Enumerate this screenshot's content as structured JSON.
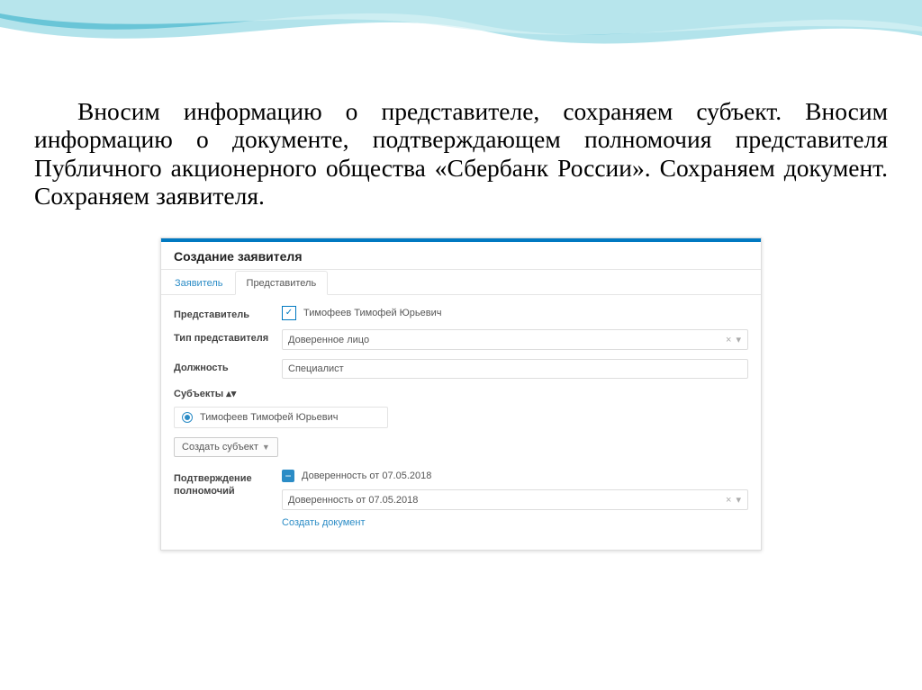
{
  "instruction_text": "Вносим информацию о представителе, сохраняем субъект. Вносим информацию о документе, подтверждающем полномочия представителя Публичного акционерного общества «Сбербанк России». Сохраняем документ. Сохраняем заявителя.",
  "panel": {
    "title": "Создание заявителя",
    "tabs": {
      "applicant": "Заявитель",
      "representative": "Представитель"
    },
    "fields": {
      "representative_label": "Представитель",
      "representative_value": "Тимофеев Тимофей Юрьевич",
      "rep_type_label": "Тип представителя",
      "rep_type_value": "Доверенное лицо",
      "position_label": "Должность",
      "position_value": "Специалист",
      "subjects_label": "Субъекты ▴▾",
      "subject_value": "Тимофеев Тимофей Юрьевич",
      "create_subject": "Создать субъект",
      "authority_label": "Подтверждение полномочий",
      "doc_value": "Доверенность от 07.05.2018",
      "select_doc_value": "Доверенность от 07.05.2018",
      "create_document": "Создать документ",
      "clear_marker": "× ▾"
    }
  }
}
